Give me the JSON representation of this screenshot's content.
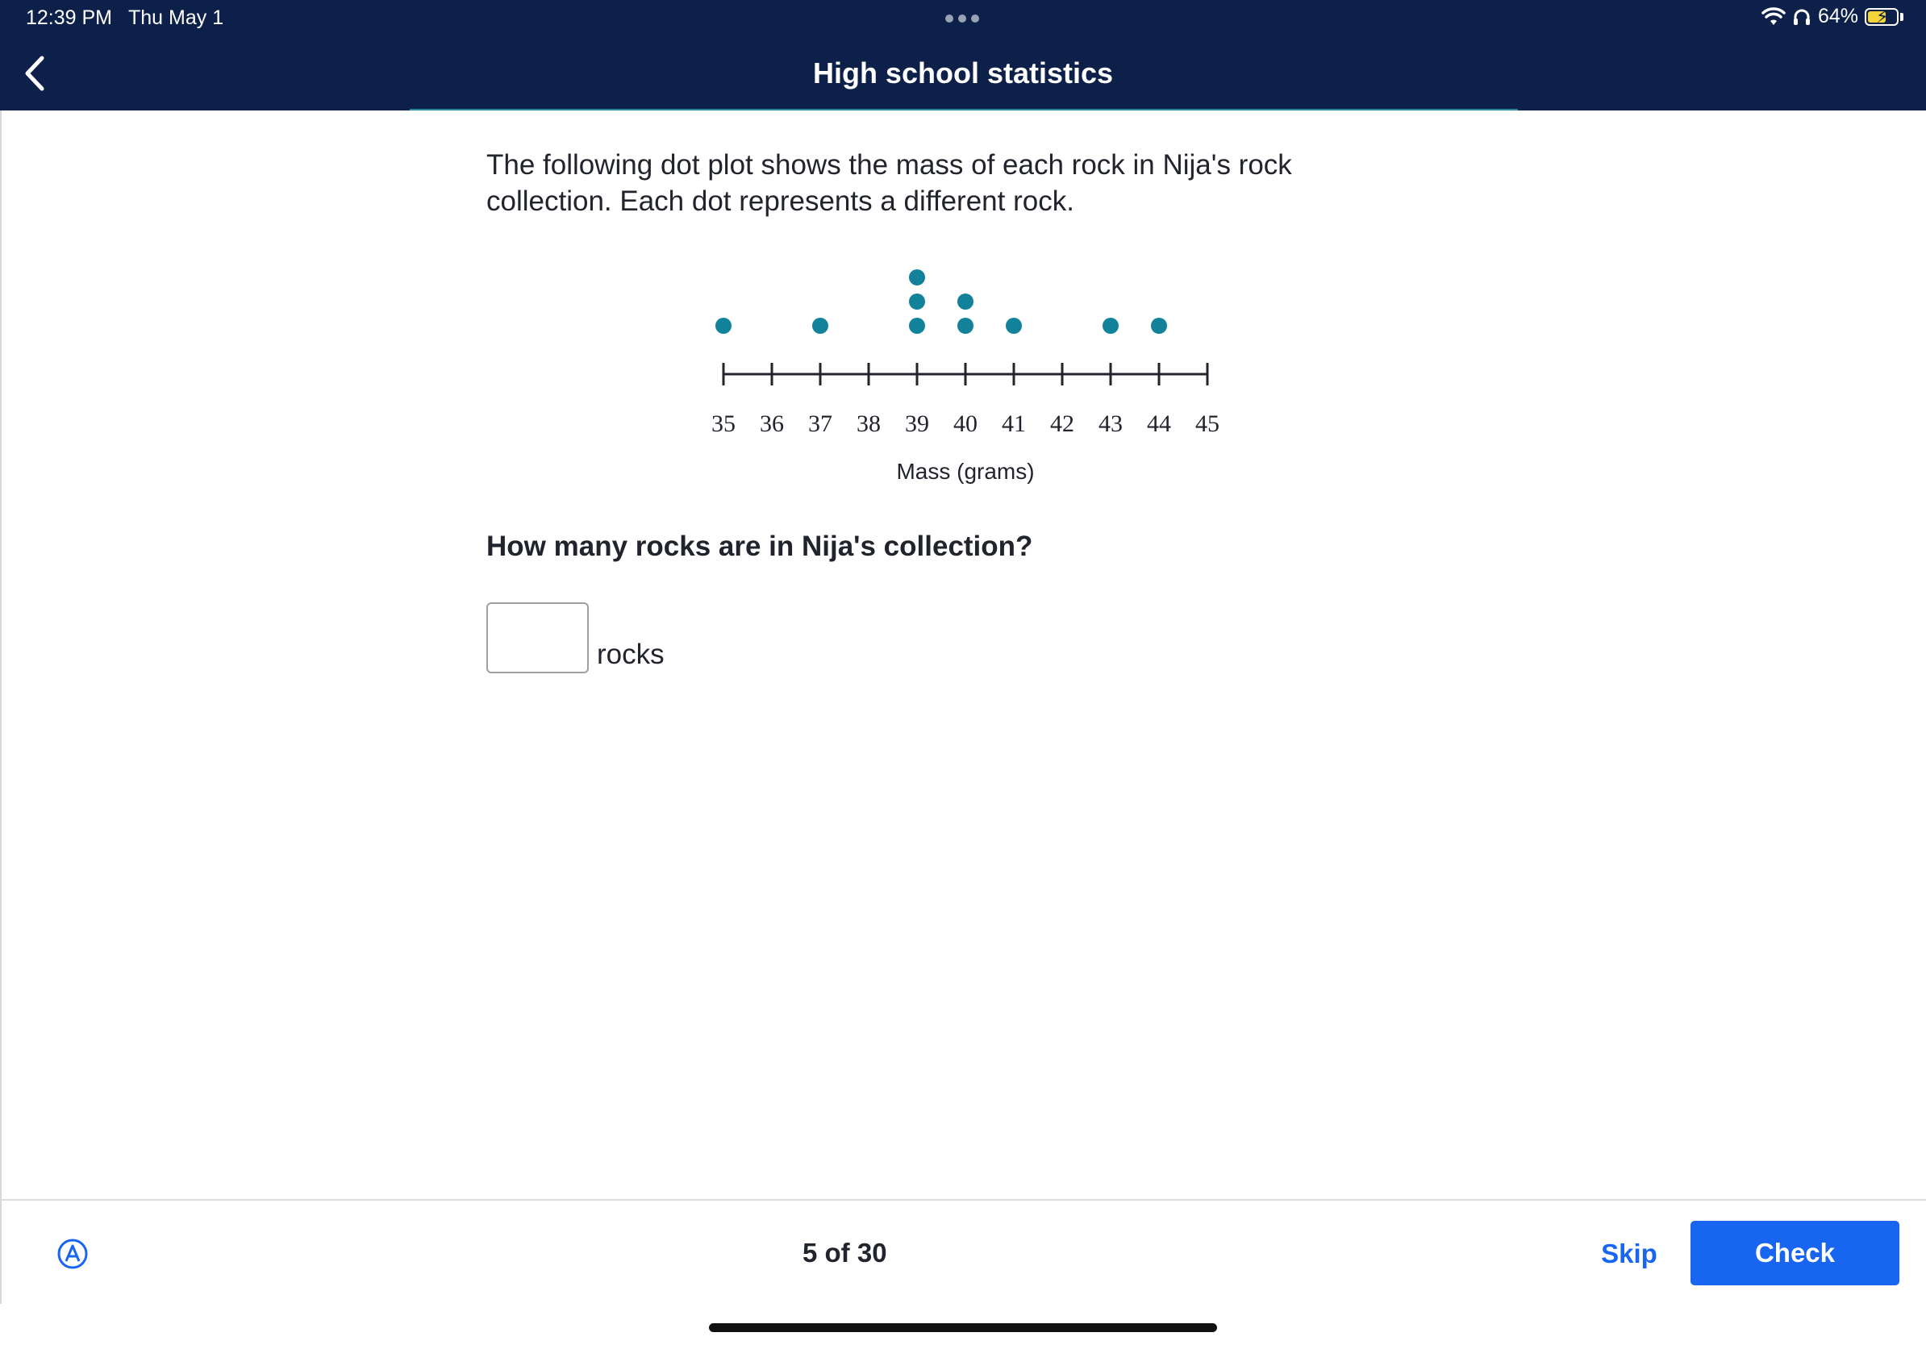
{
  "status_bar": {
    "time": "12:39 PM",
    "date": "Thu May 1",
    "battery": "64%",
    "battery_level": 0.64
  },
  "header": {
    "title": "High school statistics"
  },
  "exercise": {
    "prompt": "The following dot plot shows the mass of each rock in Nija's rock collection. Each dot represents a different rock.",
    "question": "How many rocks are in Nija's collection?",
    "answer_value": "",
    "answer_placeholder": "",
    "unit": "rocks"
  },
  "chart_data": {
    "type": "scatter",
    "subtype": "dot-plot",
    "xlabel": "Mass (grams)",
    "ticks": [
      35,
      36,
      37,
      38,
      39,
      40,
      41,
      42,
      43,
      44,
      45
    ],
    "xlim": [
      35,
      45
    ],
    "counts": [
      {
        "x": 35,
        "count": 1
      },
      {
        "x": 37,
        "count": 1
      },
      {
        "x": 39,
        "count": 3
      },
      {
        "x": 40,
        "count": 2
      },
      {
        "x": 41,
        "count": 1
      },
      {
        "x": 43,
        "count": 1
      },
      {
        "x": 44,
        "count": 1
      }
    ],
    "dot_color": "#11829a",
    "grid": false
  },
  "footer": {
    "progress": "5 of 30",
    "skip_label": "Skip",
    "check_label": "Check"
  },
  "colors": {
    "header_bg": "#0c2049",
    "accent": "#1865f2",
    "dot": "#11829a"
  },
  "icons": {
    "back": "chevron-left-icon",
    "accessibility": "circled-a-icon",
    "wifi": "wifi-icon",
    "headphones": "headphones-icon",
    "battery": "battery-charging-icon"
  }
}
